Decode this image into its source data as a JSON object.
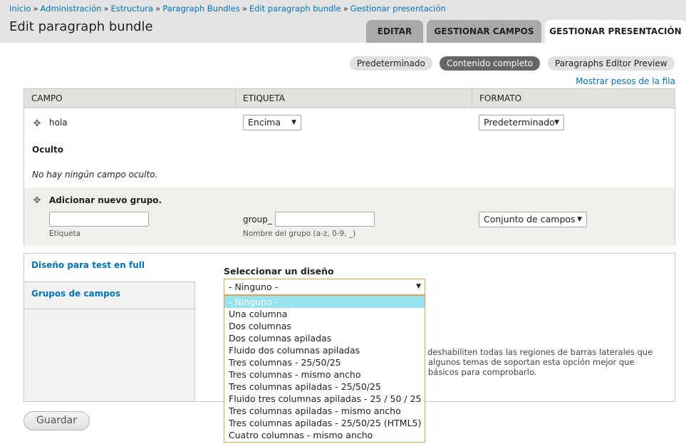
{
  "breadcrumb": [
    "Inicio",
    "Administración",
    "Estructura",
    "Paragraph Bundles",
    "Edit paragraph bundle",
    "Gestionar presentación"
  ],
  "page_title": "Edit paragraph bundle",
  "tabs": {
    "editar": "EDITAR",
    "gestionar_campos": "GESTIONAR CAMPOS",
    "gestionar_presentacion": "GESTIONAR PRESENTACIÓN"
  },
  "view_modes": [
    "Predeterminado",
    "Contenido completo",
    "Paragraphs Editor Preview"
  ],
  "active_view_mode": "Contenido completo",
  "show_row_weights": "Mostrar pesos de la fila",
  "table": {
    "headers": [
      "CAMPO",
      "ETIQUETA",
      "FORMATO"
    ],
    "field_row": {
      "name": "hola",
      "label_value": "Encima",
      "format_value": "Predeterminado"
    },
    "hidden_heading": "Oculto",
    "no_hidden": "No hay ningún campo oculto.",
    "new_group": {
      "title": "Adicionar nuevo grupo.",
      "label_caption": "Etiqueta",
      "prefix": "group_",
      "name_caption": "Nombre del grupo (a-z, 0-9, _)",
      "format_value": "Conjunto de campos"
    }
  },
  "vertical_tabs": [
    "Diseño para test en full",
    "Grupos de campos"
  ],
  "layout": {
    "label": "Seleccionar un diseño",
    "selected": "- Ninguno -",
    "options": [
      "- Ninguno -",
      "Una columna",
      "Dos columnas",
      "Dos columnas apiladas",
      "Fluido dos columnas apiladas",
      "Tres columnas - 25/50/25",
      "Tres columnas - mismo ancho",
      "Tres columnas apiladas - 25/50/25",
      "Fluido tres columnas apiladas - 25 / 50 / 25",
      "Tres columnas apiladas - mismo ancho",
      "Tres columnas apiladas - 25/50/25 (HTML5)",
      "Cuatro columnas - mismo ancho"
    ],
    "description_lines": [
      "deshabiliten todas las regiones de barras laterales que",
      "algunos temas de soportan esta opción mejor que",
      "básicos para comprobarlo."
    ]
  },
  "save_label": "Guardar",
  "colors": {
    "link": "#0074bd",
    "header_bg": "#e4e4e4",
    "active_pill": "#666666",
    "focus_border": "#e2a04a",
    "selected_option": "#97e2ef"
  }
}
